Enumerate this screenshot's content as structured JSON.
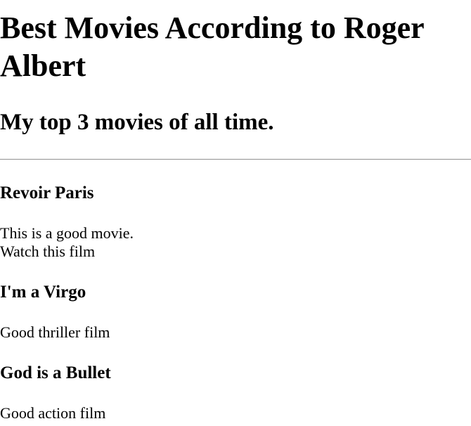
{
  "page": {
    "title": "Best Movies According to Roger Albert",
    "subtitle": "My top 3 movies of all time."
  },
  "movies": [
    {
      "title": "Revoir Paris",
      "lines": [
        "This is a good movie.",
        "Watch this film"
      ]
    },
    {
      "title": "I'm a Virgo",
      "lines": [
        "Good thriller film"
      ]
    },
    {
      "title": "God is a Bullet",
      "lines": [
        "Good action film"
      ]
    }
  ]
}
